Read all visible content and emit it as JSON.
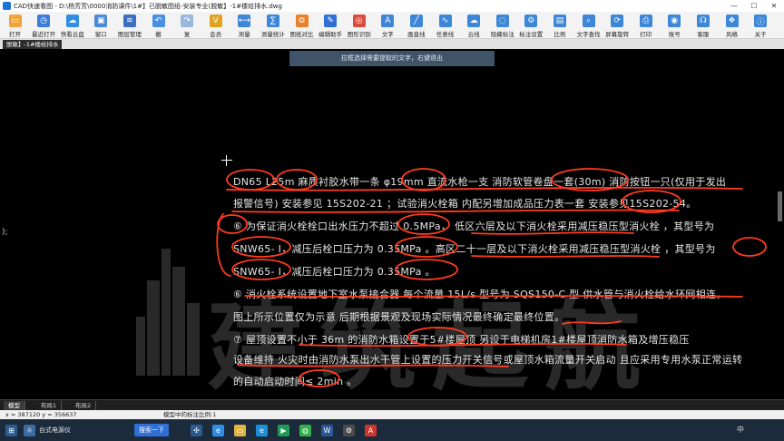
{
  "window": {
    "title": "CAD快速看图 - D:\\杨芳芳\\0000消防课件\\1#】已脱敏图纸-安装专业(脱敏】-1#楼给排水.dwg",
    "minimize": "—",
    "maximize": "☐",
    "close": "✕"
  },
  "toolbar": {
    "items": [
      {
        "id": "open",
        "label": "打开",
        "icon": "folder-icon",
        "color": "#f2a33a",
        "glyph": "▭"
      },
      {
        "id": "recent",
        "label": "最近打开",
        "icon": "recent-icon",
        "color": "#3b7dd8",
        "glyph": "◷"
      },
      {
        "id": "cloud",
        "label": "快看云盘",
        "icon": "cloud-icon",
        "color": "#2f8fe6",
        "glyph": "☁"
      },
      {
        "id": "window",
        "label": "窗口",
        "icon": "window-icon",
        "color": "#4b8ad6",
        "glyph": "▣"
      },
      {
        "id": "layers",
        "label": "图层管理",
        "icon": "layers-icon",
        "color": "#3a6fc4",
        "glyph": "≋"
      },
      {
        "id": "back",
        "label": "撤",
        "icon": "undo-icon",
        "color": "#4a90e2",
        "glyph": "↶"
      },
      {
        "id": "redo",
        "label": "复",
        "icon": "redo-icon",
        "color": "#9ab8dd",
        "glyph": "↷"
      },
      {
        "id": "vip",
        "label": "会员",
        "icon": "vip-icon",
        "color": "#e0a320",
        "glyph": "V"
      },
      {
        "id": "measure",
        "label": "测量",
        "icon": "measure-icon",
        "color": "#3d86d8",
        "glyph": "⟷"
      },
      {
        "id": "measure-stats",
        "label": "测量统计",
        "icon": "measure-stats-icon",
        "color": "#3d86d8",
        "glyph": "∑"
      },
      {
        "id": "compare",
        "label": "图纸对比",
        "icon": "compare-icon",
        "color": "#e9812b",
        "glyph": "⧉"
      },
      {
        "id": "edit-helper",
        "label": "编辑助手",
        "icon": "edit-helper-icon",
        "color": "#2f6fd6",
        "glyph": "✎"
      },
      {
        "id": "recognize",
        "label": "图形识别",
        "icon": "recognize-icon",
        "color": "#d94c3d",
        "glyph": "◎"
      },
      {
        "id": "text",
        "label": "文字",
        "icon": "text-icon",
        "color": "#3d86d8",
        "glyph": "A"
      },
      {
        "id": "line",
        "label": "画直线",
        "icon": "line-icon",
        "color": "#3d86d8",
        "glyph": "╱"
      },
      {
        "id": "freeline",
        "label": "任意线",
        "icon": "freeline-icon",
        "color": "#3d86d8",
        "glyph": "∿"
      },
      {
        "id": "cloudline",
        "label": "云线",
        "icon": "cloudline-icon",
        "color": "#3d86d8",
        "glyph": "☁"
      },
      {
        "id": "hide-mark",
        "label": "隐藏标注",
        "icon": "hide-mark-icon",
        "color": "#3d86d8",
        "glyph": "◌"
      },
      {
        "id": "mark-settings",
        "label": "标注设置",
        "icon": "mark-settings-icon",
        "color": "#3d86d8",
        "glyph": "⚙"
      },
      {
        "id": "scale",
        "label": "比例",
        "icon": "scale-icon",
        "color": "#3d86d8",
        "glyph": "▤"
      },
      {
        "id": "text-search",
        "label": "文字查找",
        "icon": "text-search-icon",
        "color": "#3d86d8",
        "glyph": "⌕"
      },
      {
        "id": "rotate",
        "label": "屏幕旋转",
        "icon": "rotate-icon",
        "color": "#3d86d8",
        "glyph": "⟳"
      },
      {
        "id": "print",
        "label": "打印",
        "icon": "print-icon",
        "color": "#3d86d8",
        "glyph": "⎙"
      },
      {
        "id": "account",
        "label": "账号",
        "icon": "account-icon",
        "color": "#3d86d8",
        "glyph": "◉"
      },
      {
        "id": "service",
        "label": "客服",
        "icon": "headset-icon",
        "color": "#3d86d8",
        "glyph": "☊"
      },
      {
        "id": "style",
        "label": "风格",
        "icon": "style-icon",
        "color": "#3d86d8",
        "glyph": "❖"
      },
      {
        "id": "about",
        "label": "关于",
        "icon": "about-icon",
        "color": "#3d86d8",
        "glyph": "ⓘ"
      }
    ]
  },
  "doc_tab": {
    "label": "脱敏】-1#楼给排水"
  },
  "canvas": {
    "hint": "拉框选择需要提取的文字，右键退出",
    "stray_text": ");",
    "watermark": "建筑起航",
    "lines": [
      "DN65  L25m  麻质衬胶水带一条  φ19mm  直流水枪一支 消防软管卷盘一套(30m) 消防按钮一只(仅用于发出",
      "报警信号) 安装参见      15S202-21      ；试验消火栓箱 内配另增加成品压力表一套 安装参见15S202-54。",
      "    ⑥ 为保证消火栓栓口出水压力不超过        0.5MPa，      低区六层及以下消火栓采用减压稳压型消火栓                   ，其型号为",
      "SNW65-     Ⅰ，减压后栓口压力为        0.35MPa        。高区二十一层及以下消火栓采用减压稳压型消火栓                   ，其型号为",
      "SNW65-     Ⅰ，减压后栓口压力为        0.35MPa        。",
      "    ⑥ 消火栓系统设置地下室水泵接合器  每个流量        15L/s     型号为    SQS150-C         型 供水管与消火栓给水环网相连，",
      "图上所示位置仅为示意 后期根据景观及现场实际情况最终确定最终位置。",
      "    ⑦ 屋顶设置不小于    36m    的消防水箱设置于5#楼屋顶 另设于电梯机房1#楼屋顶消防水箱及增压稳压",
      "设备维持 火灾时由消防水泵出水干管上设置的压力开关信号或屋顶水箱流量开关启动 且应采用专用水泵正常运转",
      "的自动启动时间≤      2min      。"
    ]
  },
  "sheets": [
    {
      "label": "模型",
      "active": true
    },
    {
      "label": "布局1",
      "active": false
    },
    {
      "label": "布局2",
      "active": false
    }
  ],
  "status": {
    "coords": "x = 387120  y = 356637",
    "message": "模型中的标注比例:1"
  },
  "taskbar": {
    "weather_label": "台式电源仪",
    "search_label": "搜索一下",
    "tray": "中",
    "apps": [
      {
        "id": "app-1",
        "icon": "fan-icon",
        "color": "#2b5c8f",
        "glyph": "✣"
      },
      {
        "id": "app-2",
        "icon": "browser-icon",
        "color": "#2f8fe6",
        "glyph": "e"
      },
      {
        "id": "app-3",
        "icon": "folder-icon",
        "color": "#e3b341",
        "glyph": "▭"
      },
      {
        "id": "app-4",
        "icon": "edge-icon",
        "color": "#1c8fd8",
        "glyph": "e"
      },
      {
        "id": "app-5",
        "icon": "media-icon",
        "color": "#1e9c56",
        "glyph": "▶"
      },
      {
        "id": "app-6",
        "icon": "chat-icon",
        "color": "#2fb34a",
        "glyph": "◍"
      },
      {
        "id": "app-7",
        "icon": "word-icon",
        "color": "#2b5797",
        "glyph": "W"
      },
      {
        "id": "app-8",
        "icon": "settings-icon",
        "color": "#4b4b4b",
        "glyph": "⚙"
      },
      {
        "id": "app-9",
        "icon": "cad-icon",
        "color": "#d0342c",
        "glyph": "A"
      }
    ]
  }
}
